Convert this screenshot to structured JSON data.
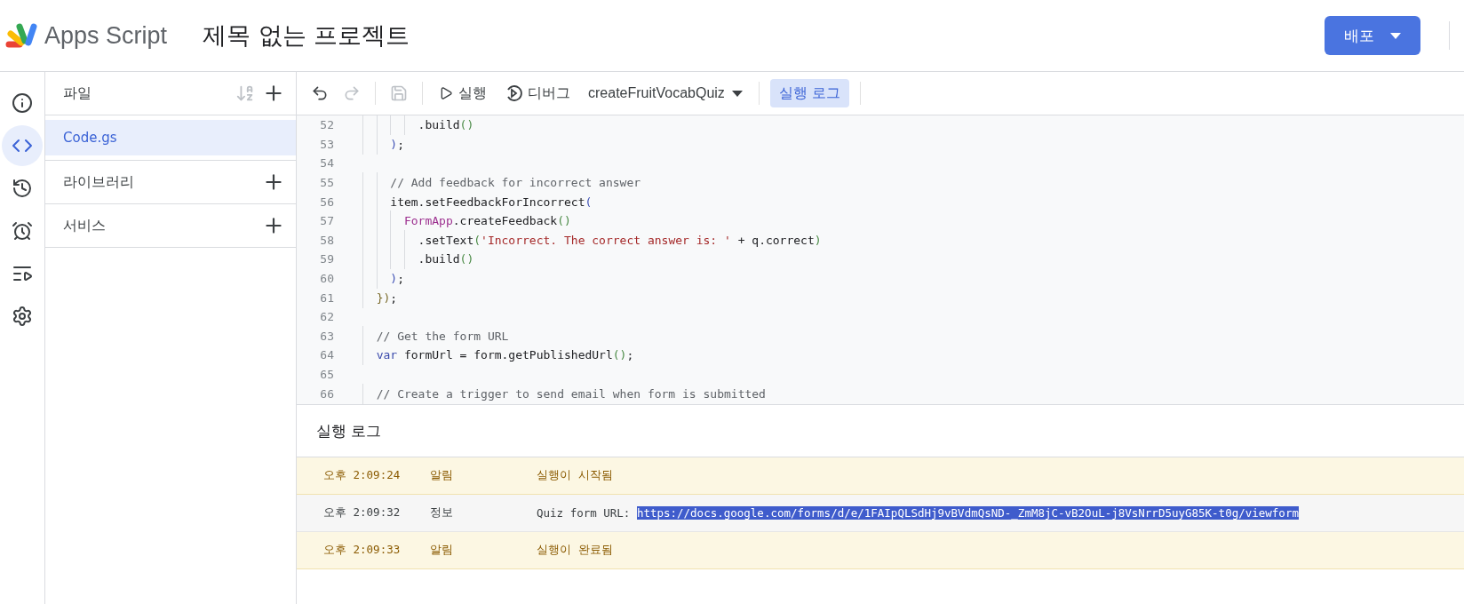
{
  "header": {
    "app_name": "Apps Script",
    "project_title": "제목 없는 프로젝트",
    "deploy_button": "배포"
  },
  "rail": [
    {
      "kind": "info",
      "selected": false
    },
    {
      "kind": "code",
      "selected": true
    },
    {
      "kind": "history",
      "selected": false
    },
    {
      "kind": "triggers",
      "selected": false
    },
    {
      "kind": "executions",
      "selected": false
    },
    {
      "kind": "settings",
      "selected": false
    }
  ],
  "files_panel": {
    "title": "파일",
    "files": [
      {
        "name": "Code.gs",
        "selected": true
      }
    ],
    "sections": [
      "라이브러리",
      "서비스"
    ]
  },
  "toolbar": {
    "undo": {
      "disabled": false
    },
    "redo": {
      "disabled": true
    },
    "save": {
      "disabled": true
    },
    "run": "실행",
    "debug": "디버그",
    "function": "createFruitVocabQuiz",
    "log_toggle": {
      "label": "실행 로그",
      "selected": true
    }
  },
  "code": [
    {
      "number": "52",
      "tokens": [
        {
          "kind": "plain",
          "text": "        .build"
        },
        {
          "kind": "paren",
          "text": "()"
        }
      ]
    },
    {
      "number": "53",
      "tokens": [
        {
          "kind": "bracket",
          "text": "    )"
        },
        {
          "kind": "plain",
          "text": ";"
        }
      ]
    },
    {
      "number": "54"
    },
    {
      "number": "55",
      "tokens": [
        {
          "kind": "comment",
          "text": "    // Add feedback for incorrect answer"
        }
      ]
    },
    {
      "number": "56",
      "tokens": [
        {
          "kind": "plain",
          "text": "    item.setFeedbackForIncorrect"
        },
        {
          "kind": "bracket",
          "text": "("
        }
      ]
    },
    {
      "number": "57",
      "tokens": [
        {
          "kind": "class",
          "text": "      FormApp"
        },
        {
          "kind": "plain",
          "text": ".createFeedback"
        },
        {
          "kind": "paren",
          "text": "()"
        }
      ]
    },
    {
      "number": "58",
      "tokens": [
        {
          "kind": "plain",
          "text": "        .setText"
        },
        {
          "kind": "paren",
          "text": "("
        },
        {
          "kind": "string",
          "text": "'Incorrect. The correct answer is: '"
        },
        {
          "kind": "plain",
          "text": " + q.correct"
        },
        {
          "kind": "paren",
          "text": ")"
        }
      ]
    },
    {
      "number": "59",
      "tokens": [
        {
          "kind": "plain",
          "text": "        .build"
        },
        {
          "kind": "paren",
          "text": "()"
        }
      ]
    },
    {
      "number": "60",
      "tokens": [
        {
          "kind": "bracket",
          "text": "    )"
        },
        {
          "kind": "plain",
          "text": ";"
        }
      ]
    },
    {
      "number": "61",
      "tokens": [
        {
          "kind": "outer",
          "text": "  })"
        },
        {
          "kind": "plain",
          "text": ";"
        }
      ]
    },
    {
      "number": "62"
    },
    {
      "number": "63",
      "tokens": [
        {
          "kind": "comment",
          "text": "  // Get the form URL"
        }
      ]
    },
    {
      "number": "64",
      "tokens": [
        {
          "kind": "keyword",
          "text": "  var"
        },
        {
          "kind": "plain",
          "text": " formUrl = form.getPublishedUrl"
        },
        {
          "kind": "paren",
          "text": "()"
        },
        {
          "kind": "plain",
          "text": ";"
        }
      ]
    },
    {
      "number": "65"
    },
    {
      "number": "66",
      "tokens": [
        {
          "kind": "comment",
          "text": "  // Create a trigger to send email when form is submitted"
        }
      ]
    }
  ],
  "log": {
    "title": "실행 로그",
    "entries": [
      {
        "kind": "notice",
        "time": "오후 2:09:24",
        "level": "알림",
        "message": "실행이 시작됨"
      },
      {
        "kind": "info",
        "time": "오후 2:09:32",
        "level": "정보",
        "message": "Quiz form URL: ",
        "highlighted_text": "https://docs.google.com/forms/d/e/1FAIpQLSdHj9vBVdmQsND-_ZmM8jC-vB2OuL-j8VsNrrD5uyG85K-t0g/viewform"
      },
      {
        "kind": "notice",
        "time": "오후 2:09:33",
        "level": "알림",
        "message": "실행이 완료됨"
      }
    ]
  }
}
